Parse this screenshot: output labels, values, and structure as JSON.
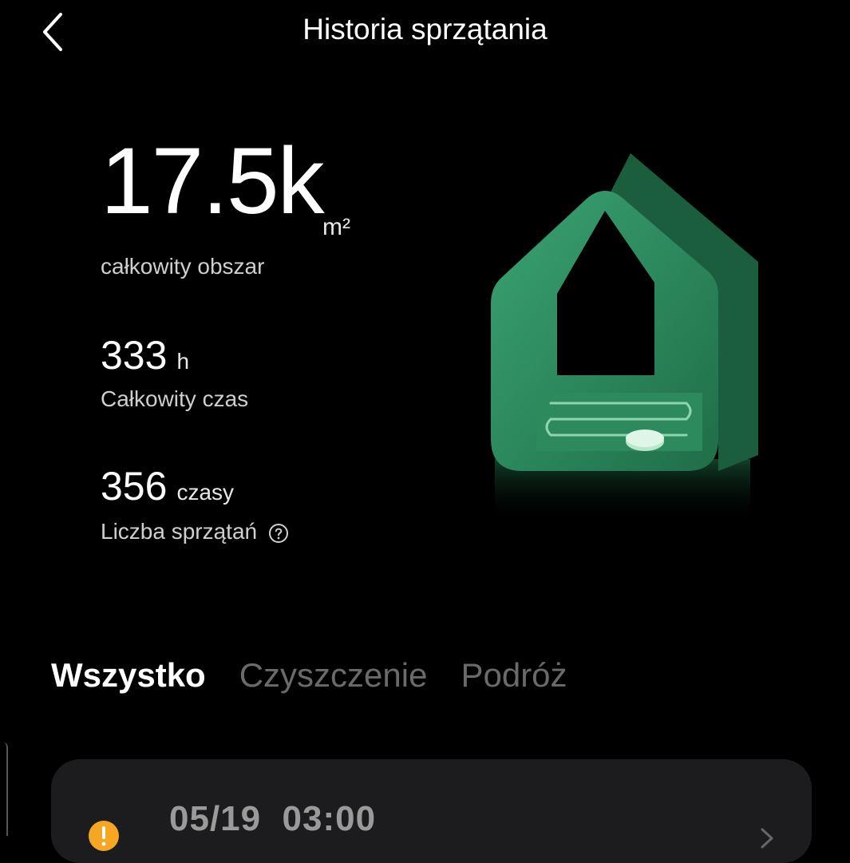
{
  "header": {
    "title": "Historia sprzątania",
    "back_icon": "chevron-left-icon"
  },
  "stats": {
    "area": {
      "value": "17.5k",
      "unit": "m²",
      "label": "całkowity obszar"
    },
    "time": {
      "value": "333",
      "unit": "h",
      "label": "Całkowity czas"
    },
    "count": {
      "value": "356",
      "unit": "czasy",
      "label": "Liczba sprzątań",
      "icon": "help-circle-icon"
    }
  },
  "illustration": {
    "icon": "house-robot-illustration",
    "color": "#2f8a5e"
  },
  "tabs": [
    {
      "label": "Wszystko",
      "active": true
    },
    {
      "label": "Czyszczenie",
      "active": false
    },
    {
      "label": "Podróż",
      "active": false
    }
  ],
  "records": [
    {
      "datetime": "05/19  03:00",
      "status_icon": "warning-icon",
      "status_color": "#f5a623"
    }
  ]
}
